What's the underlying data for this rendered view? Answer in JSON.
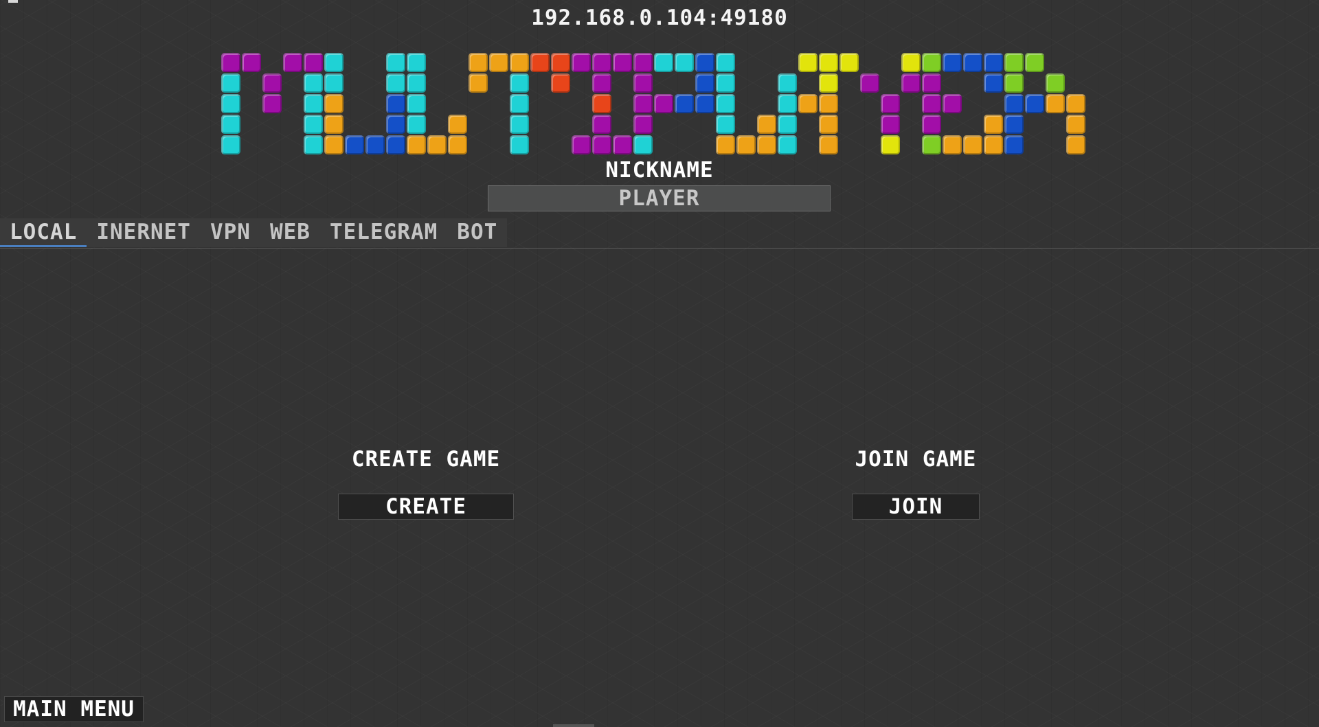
{
  "server_address": "192.168.0.104:49180",
  "logo": {
    "title": "MULTIPLAYER",
    "colors": {
      "purple": "#a20ea8",
      "cyan": "#1fd2d5",
      "orange": "#eea217",
      "blue": "#1450c8",
      "red": "#e8451a",
      "yellow": "#e2e40c",
      "green": "#7fce25"
    }
  },
  "nickname": {
    "label": "NICKNAME",
    "value": "PLAYER"
  },
  "tabs": [
    {
      "label": "LOCAL",
      "active": true
    },
    {
      "label": "INERNET",
      "active": false
    },
    {
      "label": "VPN",
      "active": false
    },
    {
      "label": "WEB",
      "active": false
    },
    {
      "label": "TELEGRAM",
      "active": false
    },
    {
      "label": "BOT",
      "active": false
    }
  ],
  "create": {
    "label": "CREATE GAME",
    "button": "CREATE"
  },
  "join": {
    "label": "JOIN GAME",
    "button": "JOIN"
  },
  "footer": {
    "main_menu": "MAIN MENU"
  }
}
